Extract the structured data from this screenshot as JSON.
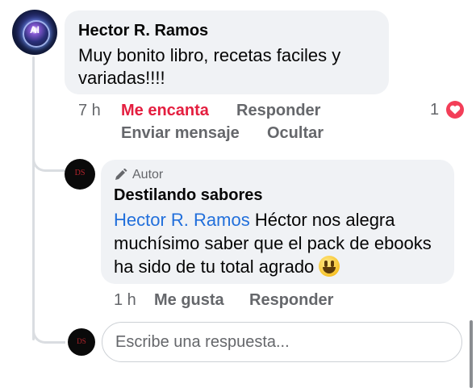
{
  "comment": {
    "author": "Hector R. Ramos",
    "text": "Muy bonito libro, recetas faciles y variadas!!!!",
    "time": "7 h",
    "actions": {
      "love": "Me encanta",
      "reply": "Responder",
      "message": "Enviar mensaje",
      "hide": "Ocultar"
    },
    "reaction_count": "1",
    "reaction_icon": "heart-icon",
    "reaction_color": "#f33e58"
  },
  "reply": {
    "author_tag": "Autor",
    "author": "Destilando sabores",
    "mention": "Hector R. Ramos",
    "text": "Héctor nos alegra muchísimo saber que el pack de ebooks ha sido de tu total agrado",
    "emoji": "grinning-face-emoji",
    "time": "1 h",
    "actions": {
      "like": "Me gusta",
      "reply": "Responder"
    }
  },
  "composer": {
    "placeholder": "Escribe una respuesta..."
  },
  "colors": {
    "bubble": "#f0f2f5",
    "link": "#216fdb",
    "love_red": "#e41e3f",
    "secondary_text": "#65676b"
  }
}
